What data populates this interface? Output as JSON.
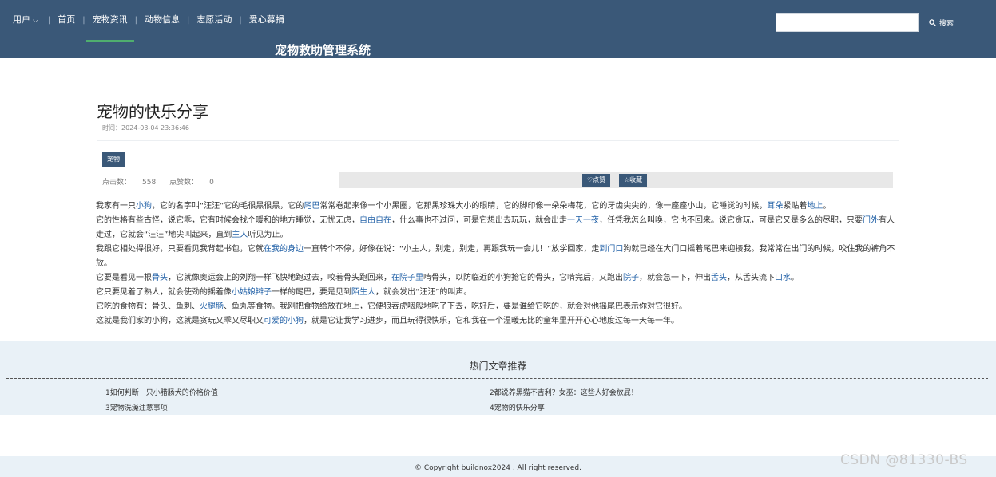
{
  "header": {
    "nav": {
      "user": "用户",
      "home": "首页",
      "pet_news": "宠物资讯",
      "animal_info": "动物信息",
      "volunteer": "志愿活动",
      "donation": "爱心募捐"
    },
    "site_title": "宠物救助管理系统",
    "search": {
      "value": "",
      "placeholder": "",
      "button_label": "搜索"
    },
    "colors": {
      "bar": "#3a5878",
      "active_underline": "#4fae6e"
    }
  },
  "article": {
    "title": "宠物的快乐分享",
    "time_label": "时间：",
    "time_value": "2024-03-04 23:36:46",
    "tag": "宠物",
    "clicks_label": "点击数：",
    "clicks_value": "558",
    "likes_label": "点赞数：",
    "likes_value": "0",
    "like_button": "点赞",
    "fav_button": "收藏",
    "paragraphs": [
      "我家有一只小狗，它的名字叫“汪汪”它的毛很黑很黑，它的尾巴常常卷起来像一个小黑圈，它那黑珍珠大小的眼睛，它的脚印像一朵朵梅花，它的牙齿尖尖的，像一座座小山，它睡觉的时候，耳朵紧贴着地上。",
      "它的性格有些古怪，说它乖，它有时候会找个暖和的地方睡觉，无忧无虑，自由自在，什么事也不过问，可是它想出去玩玩，就会出走一天一夜，任凭我怎么叫唤，它也不回来。说它贪玩，可是它又是多么的尽职，只要门外有人走过，它就会“汪汪”地尖叫起来，直到主人听见为止。",
      "我跟它相处得很好，只要看见我背起书包，它就在我的身边一直转个不停，好像在说：“小主人，别走，别走，再跟我玩一会儿！”放学回家，走到门口狗就已经在大门口摇着尾巴来迎接我。我常常在出门的时候，咬住我的裤角不放。",
      "它要是看见一根骨头，它就像奥运会上的刘翔一样飞快地跑过去，咬着骨头跑回来，在院子里啃骨头，以防临近的小狗抢它的骨头，它啃完后，又跑出院子，就会急一下，伸出舌头，从舌头流下口水。",
      "它只要见着了熟人，就会使劲的摇着像小姑娘辫子一样的尾巴，要是见到陌生人，就会发出“汪汪”的叫声。",
      "它吃的食物有：骨头、鱼刺、火腿肠、鱼丸等食物。我刚把食物给放在地上，它便狼吞虎咽般地吃了下去，吃好后，要是谁给它吃的，就会对他摇尾巴表示你对它很好。",
      "这就是我们家的小狗，这就是贪玩又乖又尽职又可爱的小狗，就是它让我学习进步，而且玩得很快乐，它和我在一个温暖无比的童年里开开心心地度过每一天每一年。"
    ]
  },
  "hot": {
    "title": "热门文章推荐",
    "items": [
      "1如何判断一只小腊肠犬的价格价值",
      "2都说养黑猫不吉利？女巫：这些人好会放屁！",
      "3宠物洗澡注意事项",
      "4宠物的快乐分享"
    ]
  },
  "footer": {
    "copyright": "© Copyright buildnox2024 . All right reserved."
  },
  "watermark": "CSDN @81330-BS"
}
